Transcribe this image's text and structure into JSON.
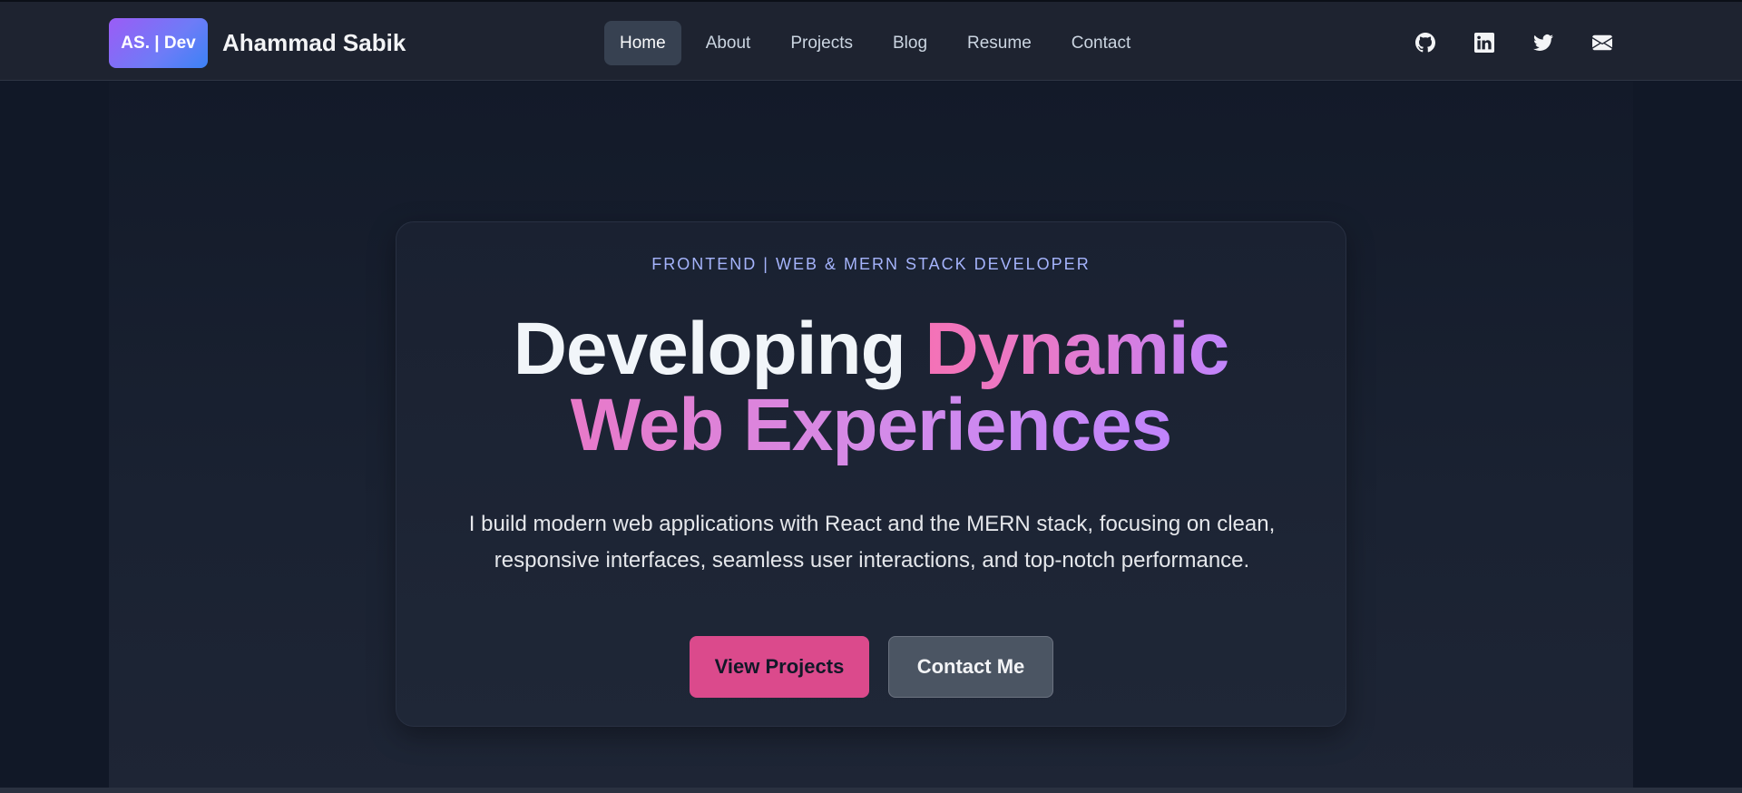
{
  "navbar": {
    "logo_badge": "AS. | Dev",
    "brand_name": "Ahammad Sabik",
    "links": [
      {
        "label": "Home",
        "active": true
      },
      {
        "label": "About",
        "active": false
      },
      {
        "label": "Projects",
        "active": false
      },
      {
        "label": "Blog",
        "active": false
      },
      {
        "label": "Resume",
        "active": false
      },
      {
        "label": "Contact",
        "active": false
      }
    ],
    "socials": [
      "github-icon",
      "linkedin-icon",
      "twitter-icon",
      "envelope-icon"
    ]
  },
  "hero": {
    "eyebrow": "FRONTEND | WEB & MERN STACK DEVELOPER",
    "headline_word1": "Developing",
    "headline_word2": "Dynamic",
    "headline_line2": "Web Experiences",
    "description": "I build modern web applications with React and the MERN stack, focusing on clean, responsive interfaces, seamless user interactions, and top-notch performance.",
    "primary_button": "View Projects",
    "secondary_button": "Contact Me"
  },
  "colors": {
    "background": "#111827",
    "navbar": "#1e2330",
    "accent_pink": "#db4a8c",
    "accent_purple": "#c084fc",
    "eyebrow": "#a5b4fc"
  }
}
